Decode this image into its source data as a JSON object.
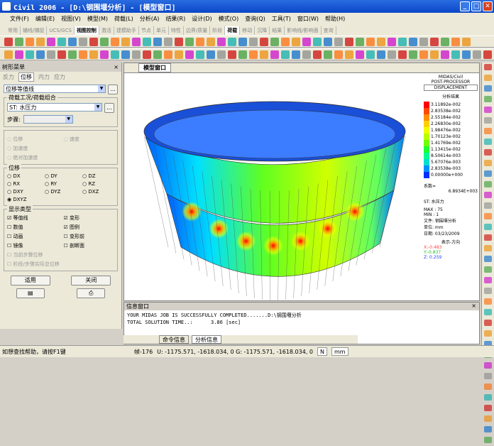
{
  "window": {
    "title": "Civil 2006 - [D:\\钢围堰分析] - [模型窗口]"
  },
  "menu": [
    "文件(F)",
    "编辑(E)",
    "视图(V)",
    "模型(M)",
    "荷载(L)",
    "分析(A)",
    "结果(R)",
    "设计(D)",
    "模式(O)",
    "查询(Q)",
    "工具(T)",
    "窗口(W)",
    "帮助(H)"
  ],
  "ribbon_tabs": [
    "常用",
    "辅线/捕捉",
    "UCS/GCS",
    "视图控制",
    "激活",
    "建模助手",
    "节点",
    "单元",
    "特性",
    "边界/质量",
    "阶段",
    "荷载",
    "移动",
    "沉降",
    "结果",
    "影响线/影响面",
    "查询"
  ],
  "tree": {
    "header": "树形菜单",
    "tabs": [
      "反力",
      "位移",
      "内力",
      "应力"
    ],
    "type_select": "位移等值线",
    "loadcase_group": "荷载工况/荷载组合",
    "loadcase_value": "ST: 水压力",
    "step_label": "步骤:",
    "motion_opts": [
      "位移",
      "速度",
      "加速度",
      "绝对加速度"
    ],
    "disp_group": "位移",
    "disp_opts": [
      "DX",
      "DY",
      "DZ",
      "RX",
      "RY",
      "RZ",
      "DXY",
      "DYZ",
      "DXZ",
      "DXYZ"
    ],
    "show_group": "显示类型",
    "show_opts": [
      "等值线",
      "变形",
      "数值",
      "图例",
      "动画",
      "变形前",
      "镜像",
      "剖断面"
    ],
    "stage_opts": [
      "当前步骤位移",
      "阶段/步骤实际总位移"
    ],
    "apply": "适用",
    "close": "关闭"
  },
  "viewport": {
    "tab": "模型窗口"
  },
  "legend": {
    "brand": "MIDAS/Civil",
    "post": "POST-PROCESSOR",
    "mode": "DISPLACEMENT",
    "title": "分析结果",
    "values": [
      "3.11892e-002",
      "2.83538e-002",
      "2.55184e-002",
      "2.26830e-002",
      "1.98476e-002",
      "1.70123e-002",
      "1.41769e-002",
      "1.13415e-002",
      "8.50614e-003",
      "5.67076e-003",
      "2.83538e-003",
      "0.00000e+000"
    ],
    "colors": [
      "#ff0000",
      "#ff4a00",
      "#ff9000",
      "#ffd000",
      "#f0ff00",
      "#b8ff00",
      "#70ff00",
      "#20ff30",
      "#00ff90",
      "#00e0d0",
      "#0090ff",
      "#0030ff"
    ],
    "factor_label": "系数=",
    "factor": "6.8934E+003",
    "case": "ST: 水压力",
    "max": "MAX : 75",
    "min": "MIN : 1",
    "file": "文件: 钢围堰分析",
    "unit": "单位: mm",
    "date": "日期: 03/23/2009",
    "dir": "表示-方向",
    "x": "X:-0.483",
    "y": "Y:-0.837",
    "z": "Z: 0.259"
  },
  "messages": {
    "header": "信息窗口",
    "lines": [
      "YOUR MIDAS JOB IS SUCCESSFULLY COMPLETED.......D:\\钢围堰分析",
      "TOTAL SOLUTION TIME..:      3.86 [sec]"
    ],
    "tabs": [
      "命令信息",
      "分析信息"
    ]
  },
  "status": {
    "help": "如想查找帮助，请按F1键",
    "frame": "帧-176",
    "coords": "U: -1175.571, -1618.034, 0  G: -1175.571, -1618.034, 0",
    "axis": "N",
    "unit": "mm"
  }
}
